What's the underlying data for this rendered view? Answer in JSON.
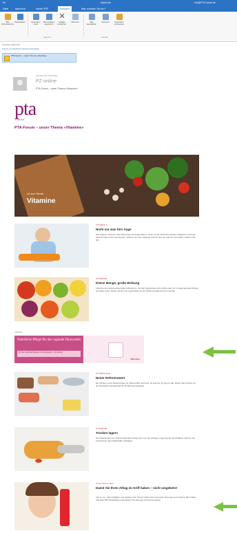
{
  "window": {
    "title": "Nachricht",
    "account": "info@PTA-forum.de",
    "quick": "E▾"
  },
  "ribbon": {
    "tabs": [
      "Datei",
      "Nachricht",
      "Adobe PDF",
      "Einfügen",
      "Was möchten Sie tun?"
    ],
    "active_tab": "Einfügen",
    "buttons": [
      {
        "label": "Alle Schnellsuche",
        "icon": "flag-icon",
        "color": "#e2a235"
      },
      {
        "label": "Weiterleiten",
        "icon": "forward-icon",
        "color": "#3f86c8"
      },
      {
        "label": "Speichern unter",
        "icon": "save-icon",
        "color": "#5b8fc7"
      },
      {
        "label": "Alle Anlagen speichern",
        "icon": "attach-save-icon",
        "color": "#5b8fc7"
      },
      {
        "label": "Anlage entfernen",
        "icon": "delete-icon",
        "color": "#555555"
      },
      {
        "label": "Alle auswählen",
        "icon": "select-all-icon",
        "color": "#7a9fd0"
      },
      {
        "label": "Kopieren",
        "icon": "copy-icon",
        "color": "#7a9fd0"
      },
      {
        "label": "Speichern verwenden",
        "icon": "export-icon",
        "color": "#e2a235"
      }
    ],
    "groups": [
      "Aktionen",
      "Speichern",
      "Auswahl"
    ]
  },
  "message": {
    "line1": "Vorschau Nachricht",
    "line2": "Zurück zur Nachricht   Jetzt herunterladen",
    "attachment": "PTA-Forum – unser Thema «Vitamine»"
  },
  "email": {
    "sender_small": "pta-forum.de Newsletter",
    "sender": "PZ-online",
    "sender_sub": "PTA-Forum – unser Thema «Vitamine»",
    "logo": "pta",
    "logo_sub": "FORUM",
    "headline": "PTA-Forum – unser Thema «Vitamine»",
    "hero_small": "Un zum Thema",
    "hero_big": "Vitamine"
  },
  "articles": [
    {
      "kicker": "VITAMIN A",
      "title": "Nicht nur was fürs Auge",
      "text": "Das Vitamin A kennen viele Menschen als Augenvitamin. Doch es hat zahlreiche weitere Aufgaben im Körper, etwa für Haut und Immunsystem. Woran man einen Mangel erkennt und wie man ihn vermeidet, erfahren Sie hier."
    },
    {
      "kicker": "VITAMINE",
      "title": "Kleine Menge, große Wirkung",
      "text": "Vitamine sind lebensnotwendige Substanzen, die der Organismus nicht selbst oder nur in ungenügender Menge herstellen kann. Daher müssen sie regelmäßig mit der Nahrung aufgenommen werden."
    },
    {
      "kicker": "VITAMIN B12",
      "title": "Neuer Referenzwert",
      "text": "Ein schöner neuer Referenzwert für Vitamin B12 steht fest. Er liegt bei 4,0 µg pro Tag. Dieser Wert wurde von der Deutschen Gesellschaft für Ernährung festgelegt."
    },
    {
      "kicker": "VITAMINE",
      "title": "Trocken lagern",
      "text": "Die Wirksamkeit von Vitaminpräparaten hängt auch von der richtigen Lagerung ab. Feuchtigkeit, Wärme und Licht können die Inhaltsstoffe schädigen."
    },
    {
      "kicker": "VITA AKTIV B12",
      "title": "Damit Sie Ihren Alltag im Griff haben – nicht umgekehrt",
      "text": "Viel zu tun, viele Aufgaben und ständig unter Strom? Dann kann eine gute Versorgung mit Vitamin B12 helfen. Vita aktiv B12 Direktsticks unterstützen Ihre Energie und Konzentration."
    }
  ],
  "ad": {
    "label": "ANZEIGE",
    "headline": "Natürliche Pflege für das vaginale Ökosystem",
    "subline": "Für die natürliche Balance im Intimbereich – hormonfrei",
    "brand": "Mikroben"
  },
  "colors": {
    "brand": "#8b1a6b",
    "kicker": "#c1232b",
    "arrow": "#7bc142",
    "titlebar": "#2b73c4"
  }
}
